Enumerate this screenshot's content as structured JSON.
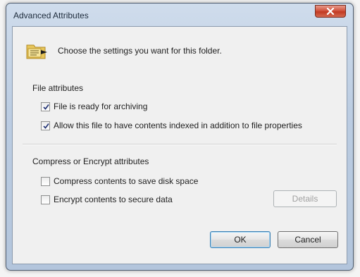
{
  "window": {
    "title": "Advanced Attributes"
  },
  "header": {
    "text": "Choose the settings you want for this folder."
  },
  "file_attributes": {
    "group_label": "File attributes",
    "options": [
      {
        "label": "File is ready for archiving",
        "checked": true
      },
      {
        "label": "Allow this file to have contents indexed in addition to file properties",
        "checked": true
      }
    ]
  },
  "compress_encrypt": {
    "group_label": "Compress or Encrypt attributes",
    "options": [
      {
        "label": "Compress contents to save disk space",
        "checked": false
      },
      {
        "label": "Encrypt contents to secure data",
        "checked": false
      }
    ],
    "details_label": "Details"
  },
  "buttons": {
    "ok_label": "OK",
    "cancel_label": "Cancel"
  },
  "colors": {
    "close_button": "#c13a22",
    "title_bar": "#bccde2",
    "client_background": "#f0f0f0"
  },
  "icons": {
    "folder": "folder-icon",
    "close": "close-icon",
    "check": "checkmark-icon"
  }
}
